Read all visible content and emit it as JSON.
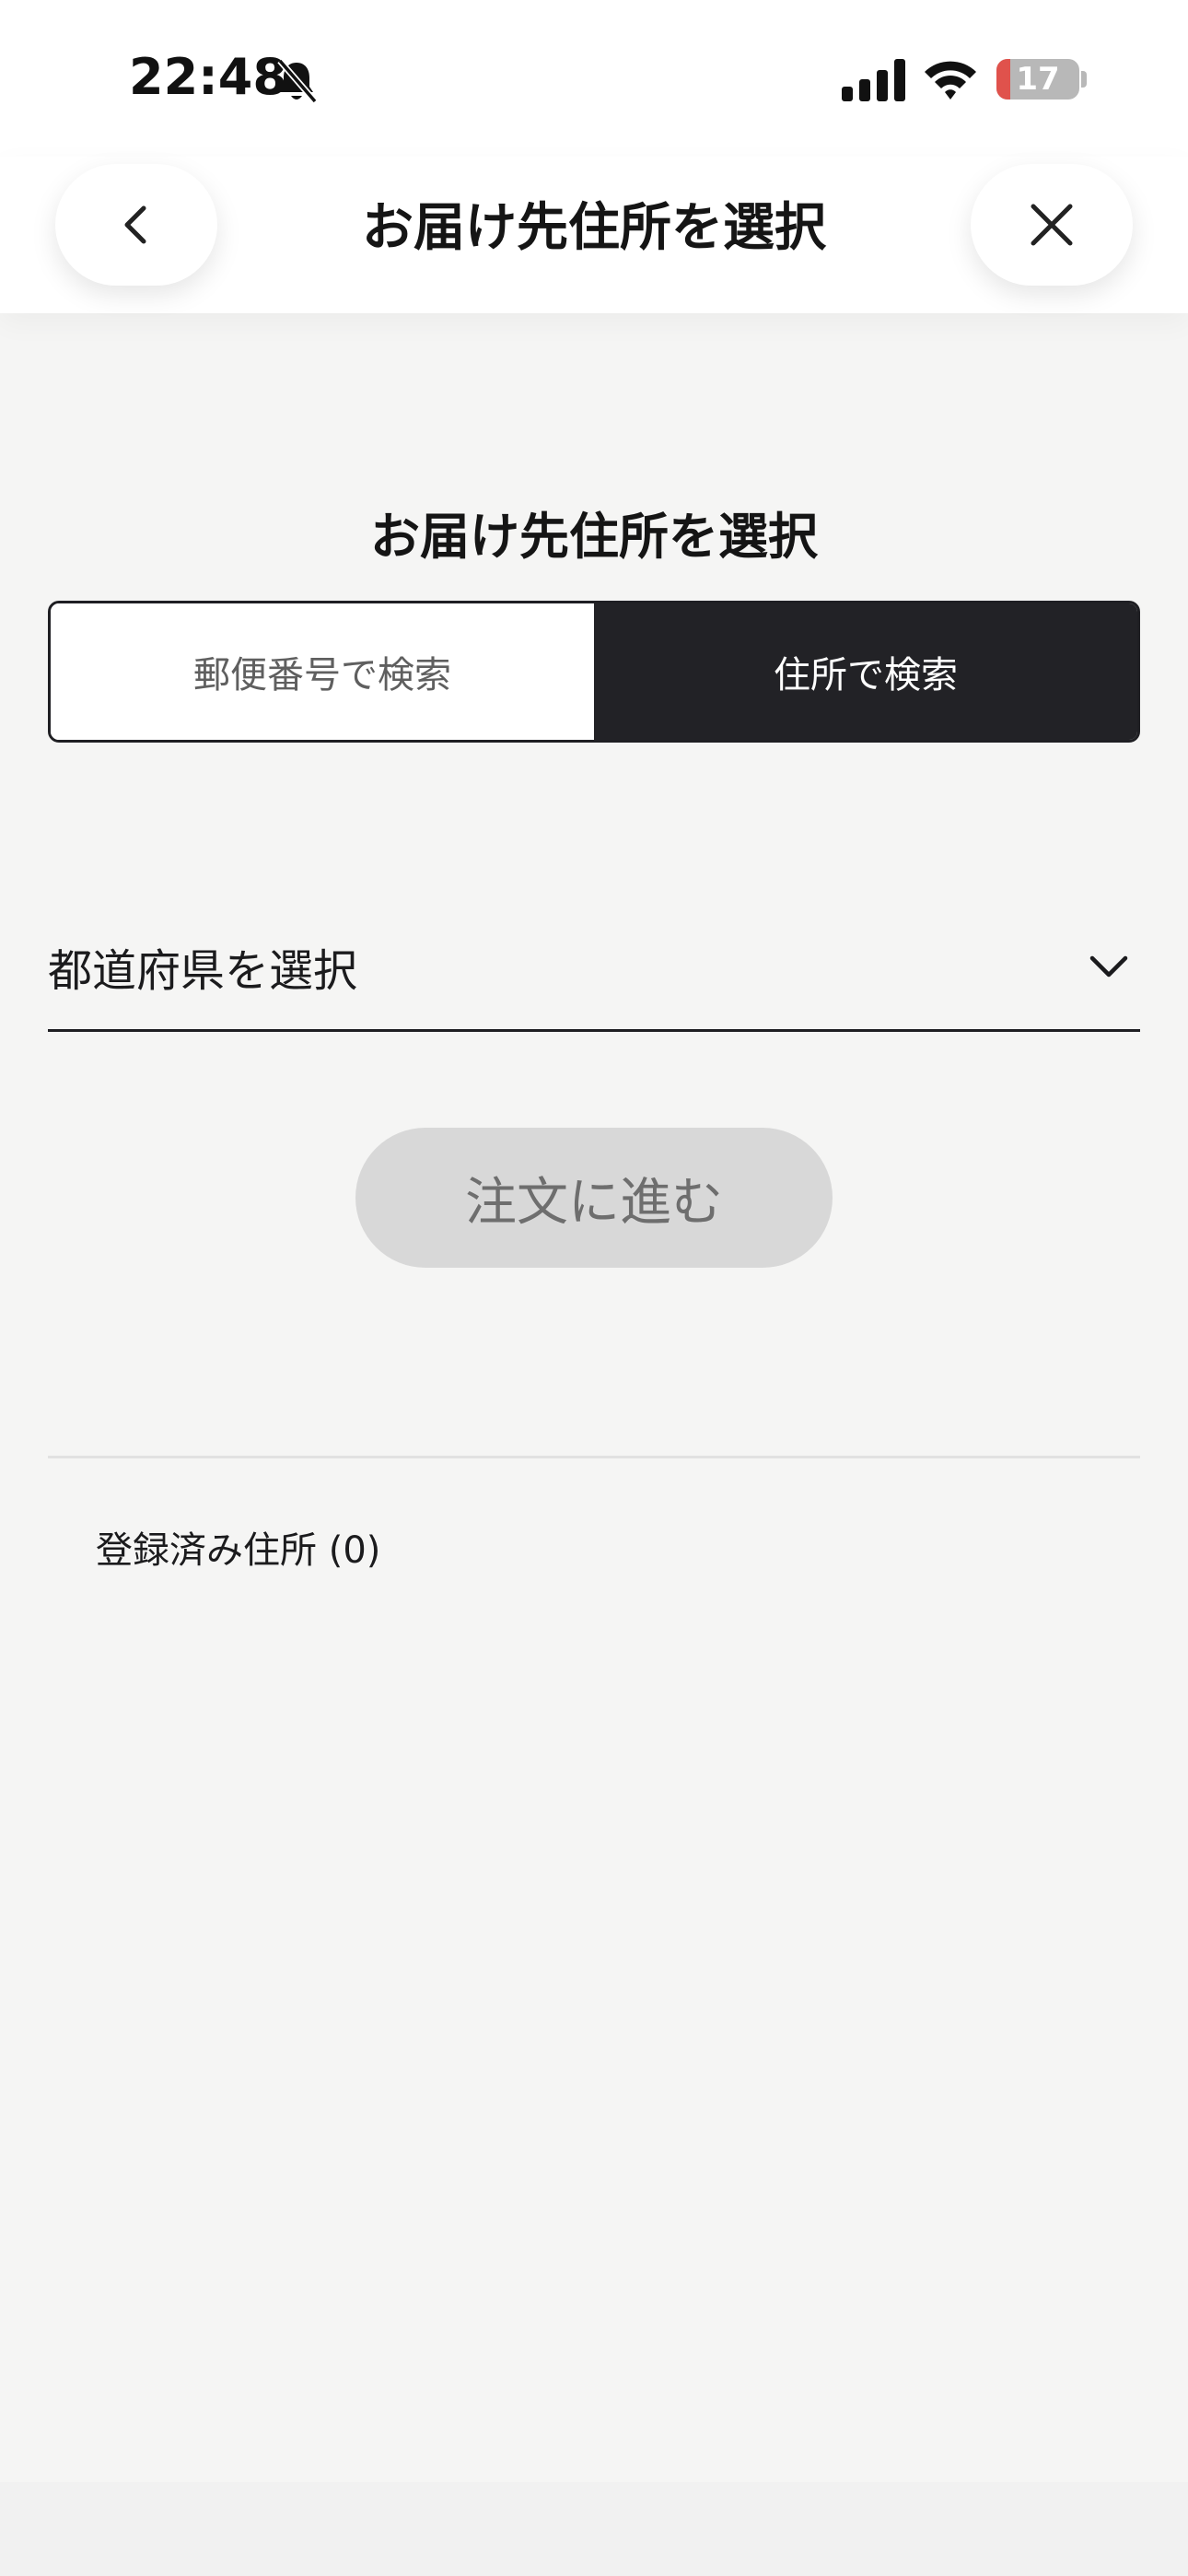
{
  "status_bar": {
    "time": "22:48",
    "battery_level": "17",
    "battery_fraction": 0.17,
    "battery_low_color": "#e0524c"
  },
  "header": {
    "title": "お届け先住所を選択",
    "back_icon": "chevron-left-icon",
    "close_icon": "close-icon"
  },
  "main": {
    "section_title": "お届け先住所を選択",
    "tabs": [
      {
        "label": "郵便番号で検索",
        "active": false
      },
      {
        "label": "住所で検索",
        "active": true
      }
    ],
    "prefecture_select": {
      "selected_value": "都道府県を選択",
      "icon": "chevron-down-icon"
    },
    "proceed_button_label": "注文に進む",
    "saved_addresses_label": "登録済み住所 (0)"
  },
  "colors": {
    "active_tab_bg": "#222226",
    "disabled_button_bg": "#d8d8d8",
    "page_bg": "#f5f5f4"
  }
}
